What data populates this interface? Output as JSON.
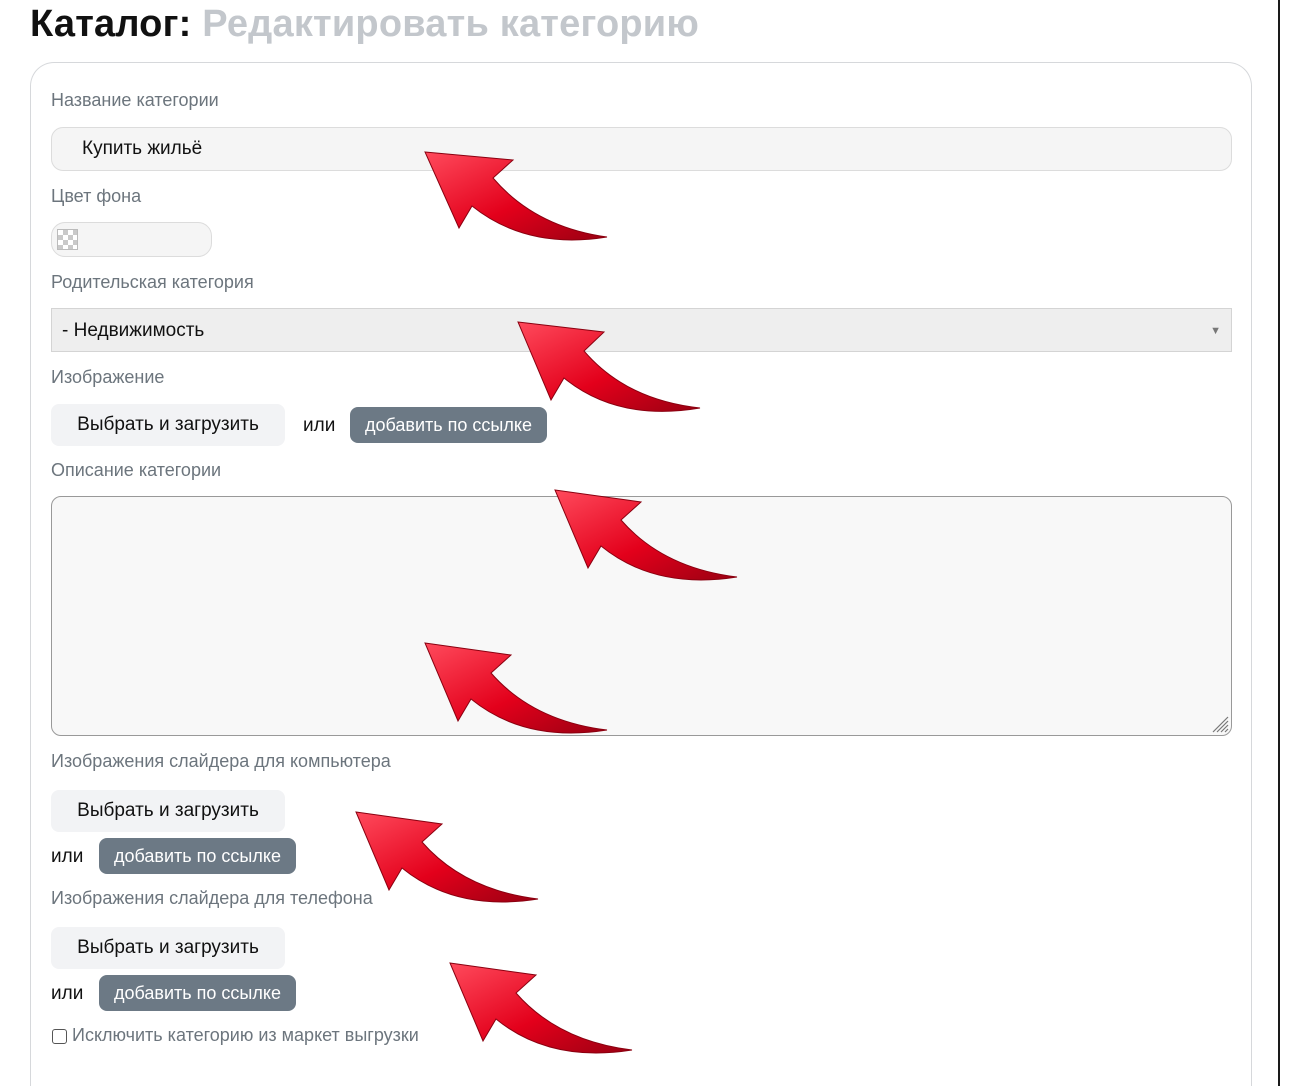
{
  "header": {
    "title": "Каталог:",
    "subtitle": "Редактировать категорию"
  },
  "form": {
    "name_label": "Название категории",
    "name_value": "Купить жильё",
    "bg_color_label": "Цвет фона",
    "parent_label": "Родительская категория",
    "parent_selected": "- Недвижимость",
    "image_label": "Изображение",
    "upload_button": "Выбрать и загрузить",
    "or_text": "или",
    "add_by_link_button": "добавить по ссылке",
    "description_label": "Описание категории",
    "description_value": "",
    "slider_desktop_label": "Изображения слайдера для компьютера",
    "slider_phone_label": "Изображения слайдера для телефона",
    "exclude_label": "Исключить категорию из маркет выгрузки",
    "exclude_checked": false
  },
  "colors": {
    "arrow": "#e3001b",
    "dark_button": "#6c7985",
    "label": "#6c757d"
  },
  "annotations": {
    "arrow_icon": "red-arrow-icon",
    "arrow_count": 6
  }
}
